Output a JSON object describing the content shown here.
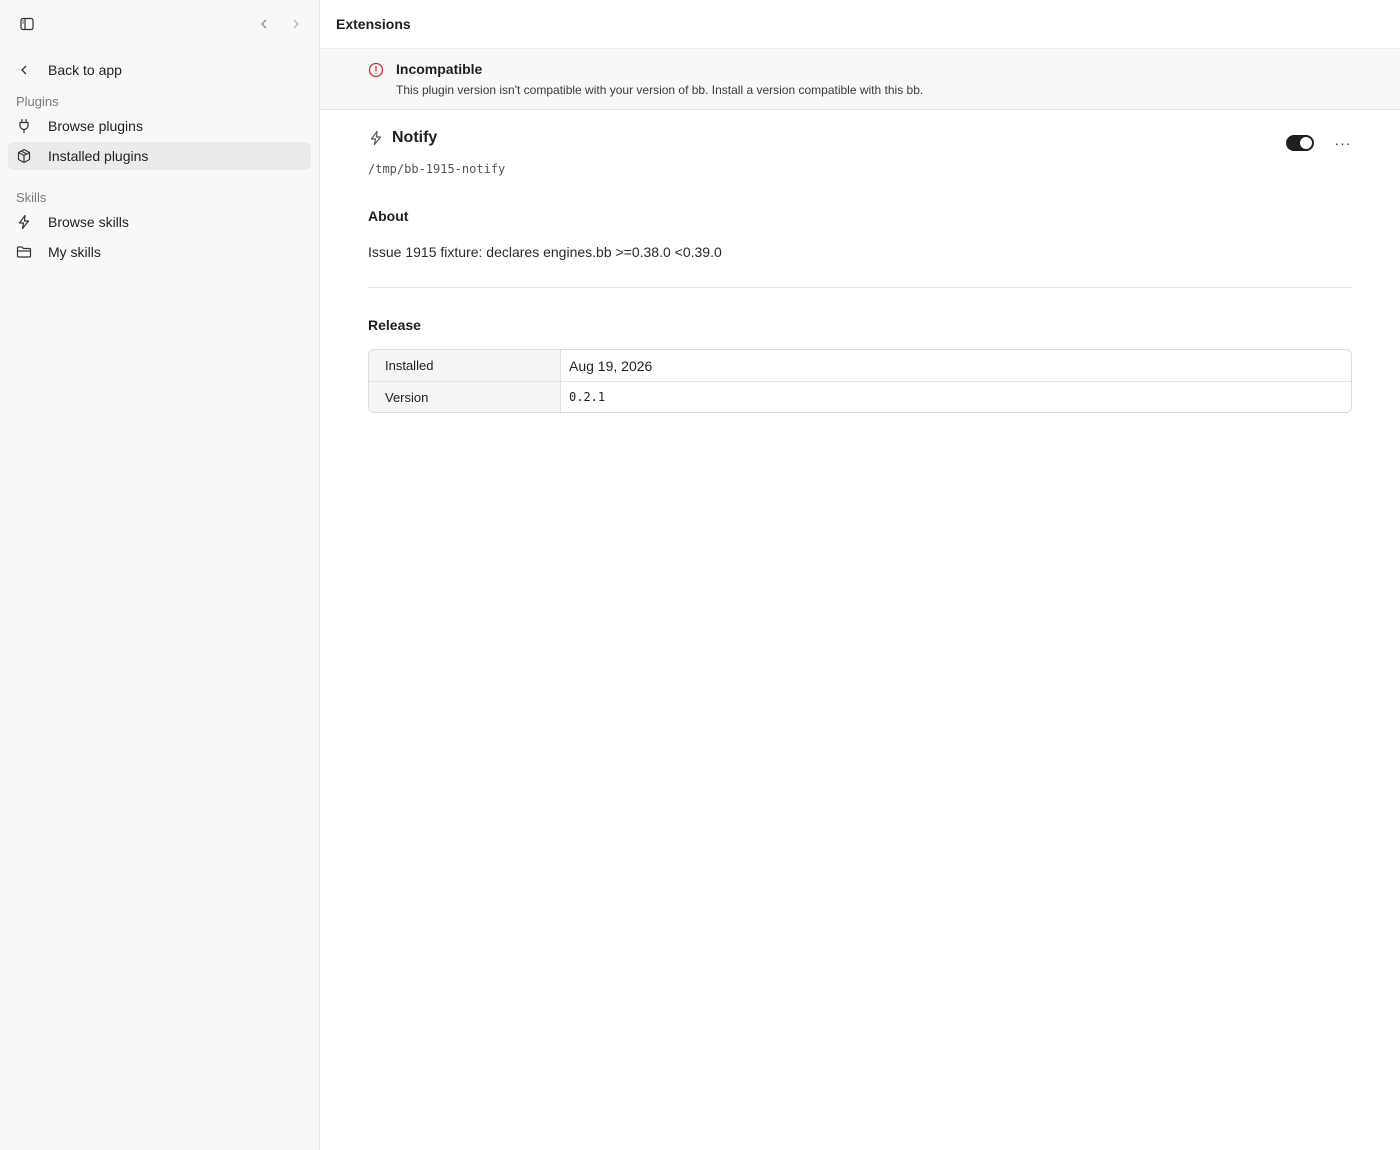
{
  "sidebar": {
    "back_label": "Back to app",
    "sections": {
      "plugins_label": "Plugins",
      "skills_label": "Skills"
    },
    "items": {
      "browse_plugins": "Browse plugins",
      "installed_plugins": "Installed plugins",
      "browse_skills": "Browse skills",
      "my_skills": "My skills"
    },
    "active_item": "installed_plugins"
  },
  "header": {
    "title": "Extensions"
  },
  "banner": {
    "title": "Incompatible",
    "description": "This plugin version isn't compatible with your version of bb. Install a version compatible with this bb.",
    "icon": "alert-circle-icon",
    "accent_color": "#c0392b"
  },
  "plugin": {
    "name": "Notify",
    "path": "/tmp/bb-1915-notify",
    "enabled": true,
    "more_label": "···"
  },
  "about": {
    "title": "About",
    "text": "Issue 1915 fixture: declares engines.bb >=0.38.0 <0.39.0"
  },
  "release": {
    "title": "Release",
    "rows": [
      {
        "key": "Installed",
        "value": "Aug 19, 2026"
      },
      {
        "key": "Version",
        "value": "0.2.1"
      }
    ]
  }
}
